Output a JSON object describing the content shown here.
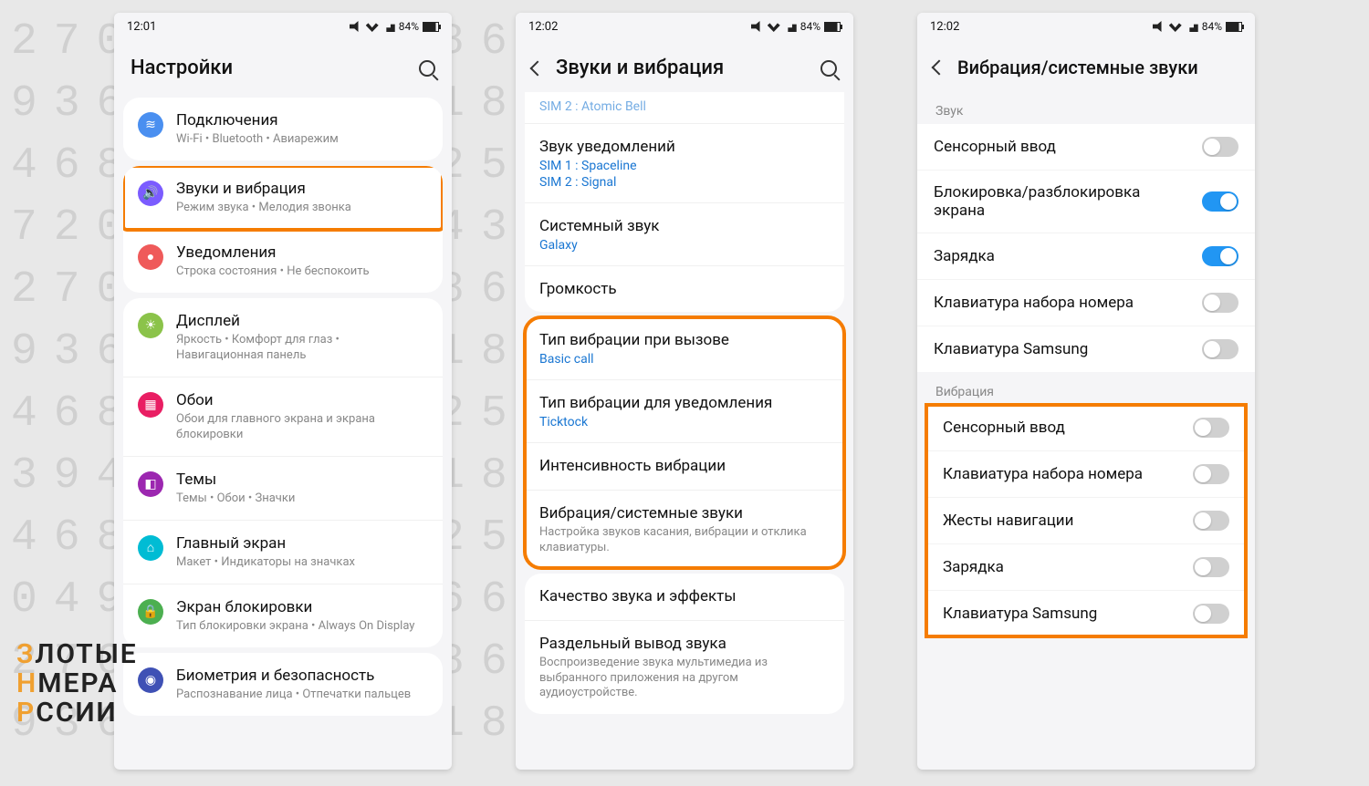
{
  "bg_digits": "2709    5186    3672\n9364    2718    1305\n4687    6925    6639\n7205    1843    7253\n2709    5186    3672\n9364    2718    1305\n4687    6925    6639\n3946    9318    6472\n4687    6925    6639\n0494    1866    4367\n2709    5186    3672\n9364    2718    1305",
  "watermark": [
    "З",
    "ЛОТЫЕ",
    "Н",
    "МЕРА",
    "Р",
    "ССИИ"
  ],
  "p1": {
    "time": "12:01",
    "battery": "84%",
    "title": "Настройки",
    "card1": [
      {
        "icon": "wifi-icon",
        "color": "#4a8ff0",
        "label": "Подключения",
        "sub": "Wi-Fi  •  Bluetooth  •  Авиарежим"
      }
    ],
    "card2": [
      {
        "icon": "volume-icon",
        "color": "#7b5cff",
        "label": "Звуки и вибрация",
        "sub": "Режим звука  •  Мелодия звонка",
        "hl": true
      },
      {
        "icon": "bell-icon",
        "color": "#ef5a5a",
        "label": "Уведомления",
        "sub": "Строка состояния  •  Не беспокоить"
      }
    ],
    "card3": [
      {
        "icon": "sun-icon",
        "color": "#8bc34a",
        "label": "Дисплей",
        "sub": "Яркость  •  Комфорт для глаз  •  Навигационная панель"
      },
      {
        "icon": "image-icon",
        "color": "#e91e63",
        "label": "Обои",
        "sub": "Обои для главного экрана и экрана блокировки"
      },
      {
        "icon": "palette-icon",
        "color": "#9c27b0",
        "label": "Темы",
        "sub": "Темы  •  Обои  •  Значки"
      },
      {
        "icon": "home-icon",
        "color": "#00bcd4",
        "label": "Главный экран",
        "sub": "Макет  •  Индикаторы на значках"
      },
      {
        "icon": "lock-icon",
        "color": "#4caf50",
        "label": "Экран блокировки",
        "sub": "Тип блокировки экрана  •  Always On Display"
      }
    ],
    "card4": [
      {
        "icon": "fingerprint-icon",
        "color": "#3f51b5",
        "label": "Биометрия и безопасность",
        "sub": "Распознавание лица  •  Отпечатки пальцев"
      }
    ]
  },
  "p2": {
    "time": "12:02",
    "battery": "84%",
    "title": "Звуки и вибрация",
    "top_blue": "SIM 2 : Atomic Bell",
    "items_a": [
      {
        "label": "Звук уведомлений",
        "blue": [
          "SIM 1 : Spaceline",
          "SIM 2 : Signal"
        ]
      },
      {
        "label": "Системный звук",
        "blue": [
          "Galaxy"
        ]
      },
      {
        "label": "Громкость"
      }
    ],
    "items_b": [
      {
        "label": "Тип вибрации при вызове",
        "blue": [
          "Basic call"
        ]
      },
      {
        "label": "Тип вибрации для уведомления",
        "blue": [
          "Ticktock"
        ]
      },
      {
        "label": "Интенсивность вибрации"
      },
      {
        "label": "Вибрация/системные звуки",
        "sub": "Настройка звуков касания, вибрации и отклика клавиатуры."
      }
    ],
    "items_c": [
      {
        "label": "Качество звука и эффекты"
      },
      {
        "label": "Раздельный вывод звука",
        "sub": "Воспроизведение звука мультимедиа из выбранного приложения на другом аудиоустройстве."
      }
    ]
  },
  "p3": {
    "time": "12:02",
    "battery": "84%",
    "title": "Вибрация/системные звуки",
    "sec_sound": "Звук",
    "sound_items": [
      {
        "label": "Сенсорный ввод",
        "on": false
      },
      {
        "label": "Блокировка/разблокировка экрана",
        "on": true
      },
      {
        "label": "Зарядка",
        "on": true
      },
      {
        "label": "Клавиатура набора номера",
        "on": false
      },
      {
        "label": "Клавиатура Samsung",
        "on": false
      }
    ],
    "sec_vib": "Вибрация",
    "vib_items": [
      {
        "label": "Сенсорный ввод",
        "on": false
      },
      {
        "label": "Клавиатура набора номера",
        "on": false
      },
      {
        "label": "Жесты навигации",
        "on": false
      },
      {
        "label": "Зарядка",
        "on": false
      },
      {
        "label": "Клавиатура Samsung",
        "on": false
      }
    ]
  }
}
